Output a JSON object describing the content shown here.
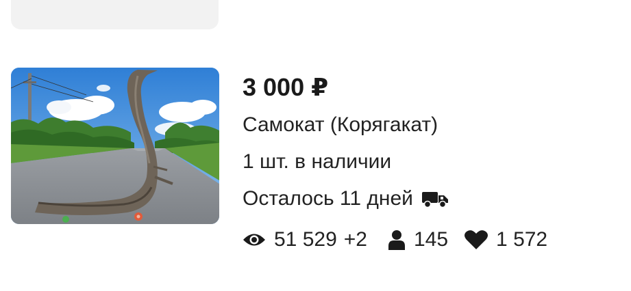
{
  "listing": {
    "price": "3 000 ₽",
    "title": "Самокат (Корягакат)",
    "stock": "1 шт. в наличии",
    "remaining": "Осталось 11 дней",
    "delivery_icon": "truck-icon",
    "stats": {
      "views": "51 529",
      "views_delta": "+2",
      "buyers": "145",
      "likes": "1 572"
    }
  },
  "colors": {
    "text": "#1f1f1f",
    "placeholder_card": "#f2f2f2"
  }
}
